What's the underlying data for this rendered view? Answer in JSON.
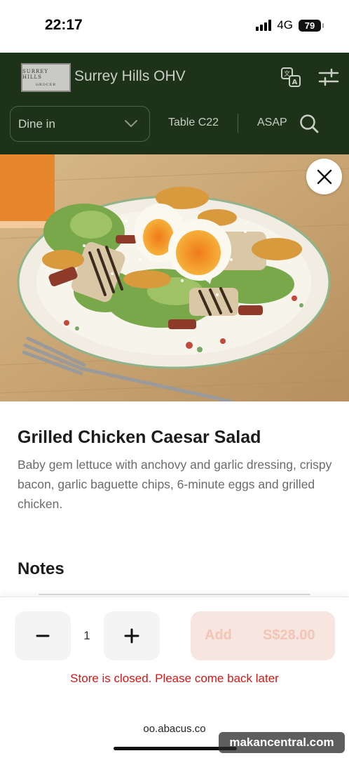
{
  "status_bar": {
    "time": "22:17",
    "network": "4G",
    "battery": "79"
  },
  "header": {
    "logo_line1": "SURREY HILLS",
    "logo_line2": "GROCER",
    "store_name": "Surrey Hills OHV",
    "dine_mode": "Dine in",
    "table": "Table C22",
    "time_option": "ASAP"
  },
  "item": {
    "title": "Grilled Chicken Caesar Salad",
    "description": "Baby gem lettuce with anchovy and garlic dressing, crispy bacon, garlic baguette chips, 6-minute eggs and grilled chicken."
  },
  "notes": {
    "title": "Notes"
  },
  "order": {
    "quantity": "1",
    "add_label": "Add",
    "price": "S$28.00",
    "closed_message": "Store is closed. Please come back later"
  },
  "browser": {
    "url": "oo.abacus.co",
    "watermark": "makancentral.com"
  },
  "colors": {
    "header_bg": "#1e3219",
    "accent_closed": "#d01818",
    "add_bg": "#f7e5df",
    "add_text": "#f2c5b7"
  }
}
